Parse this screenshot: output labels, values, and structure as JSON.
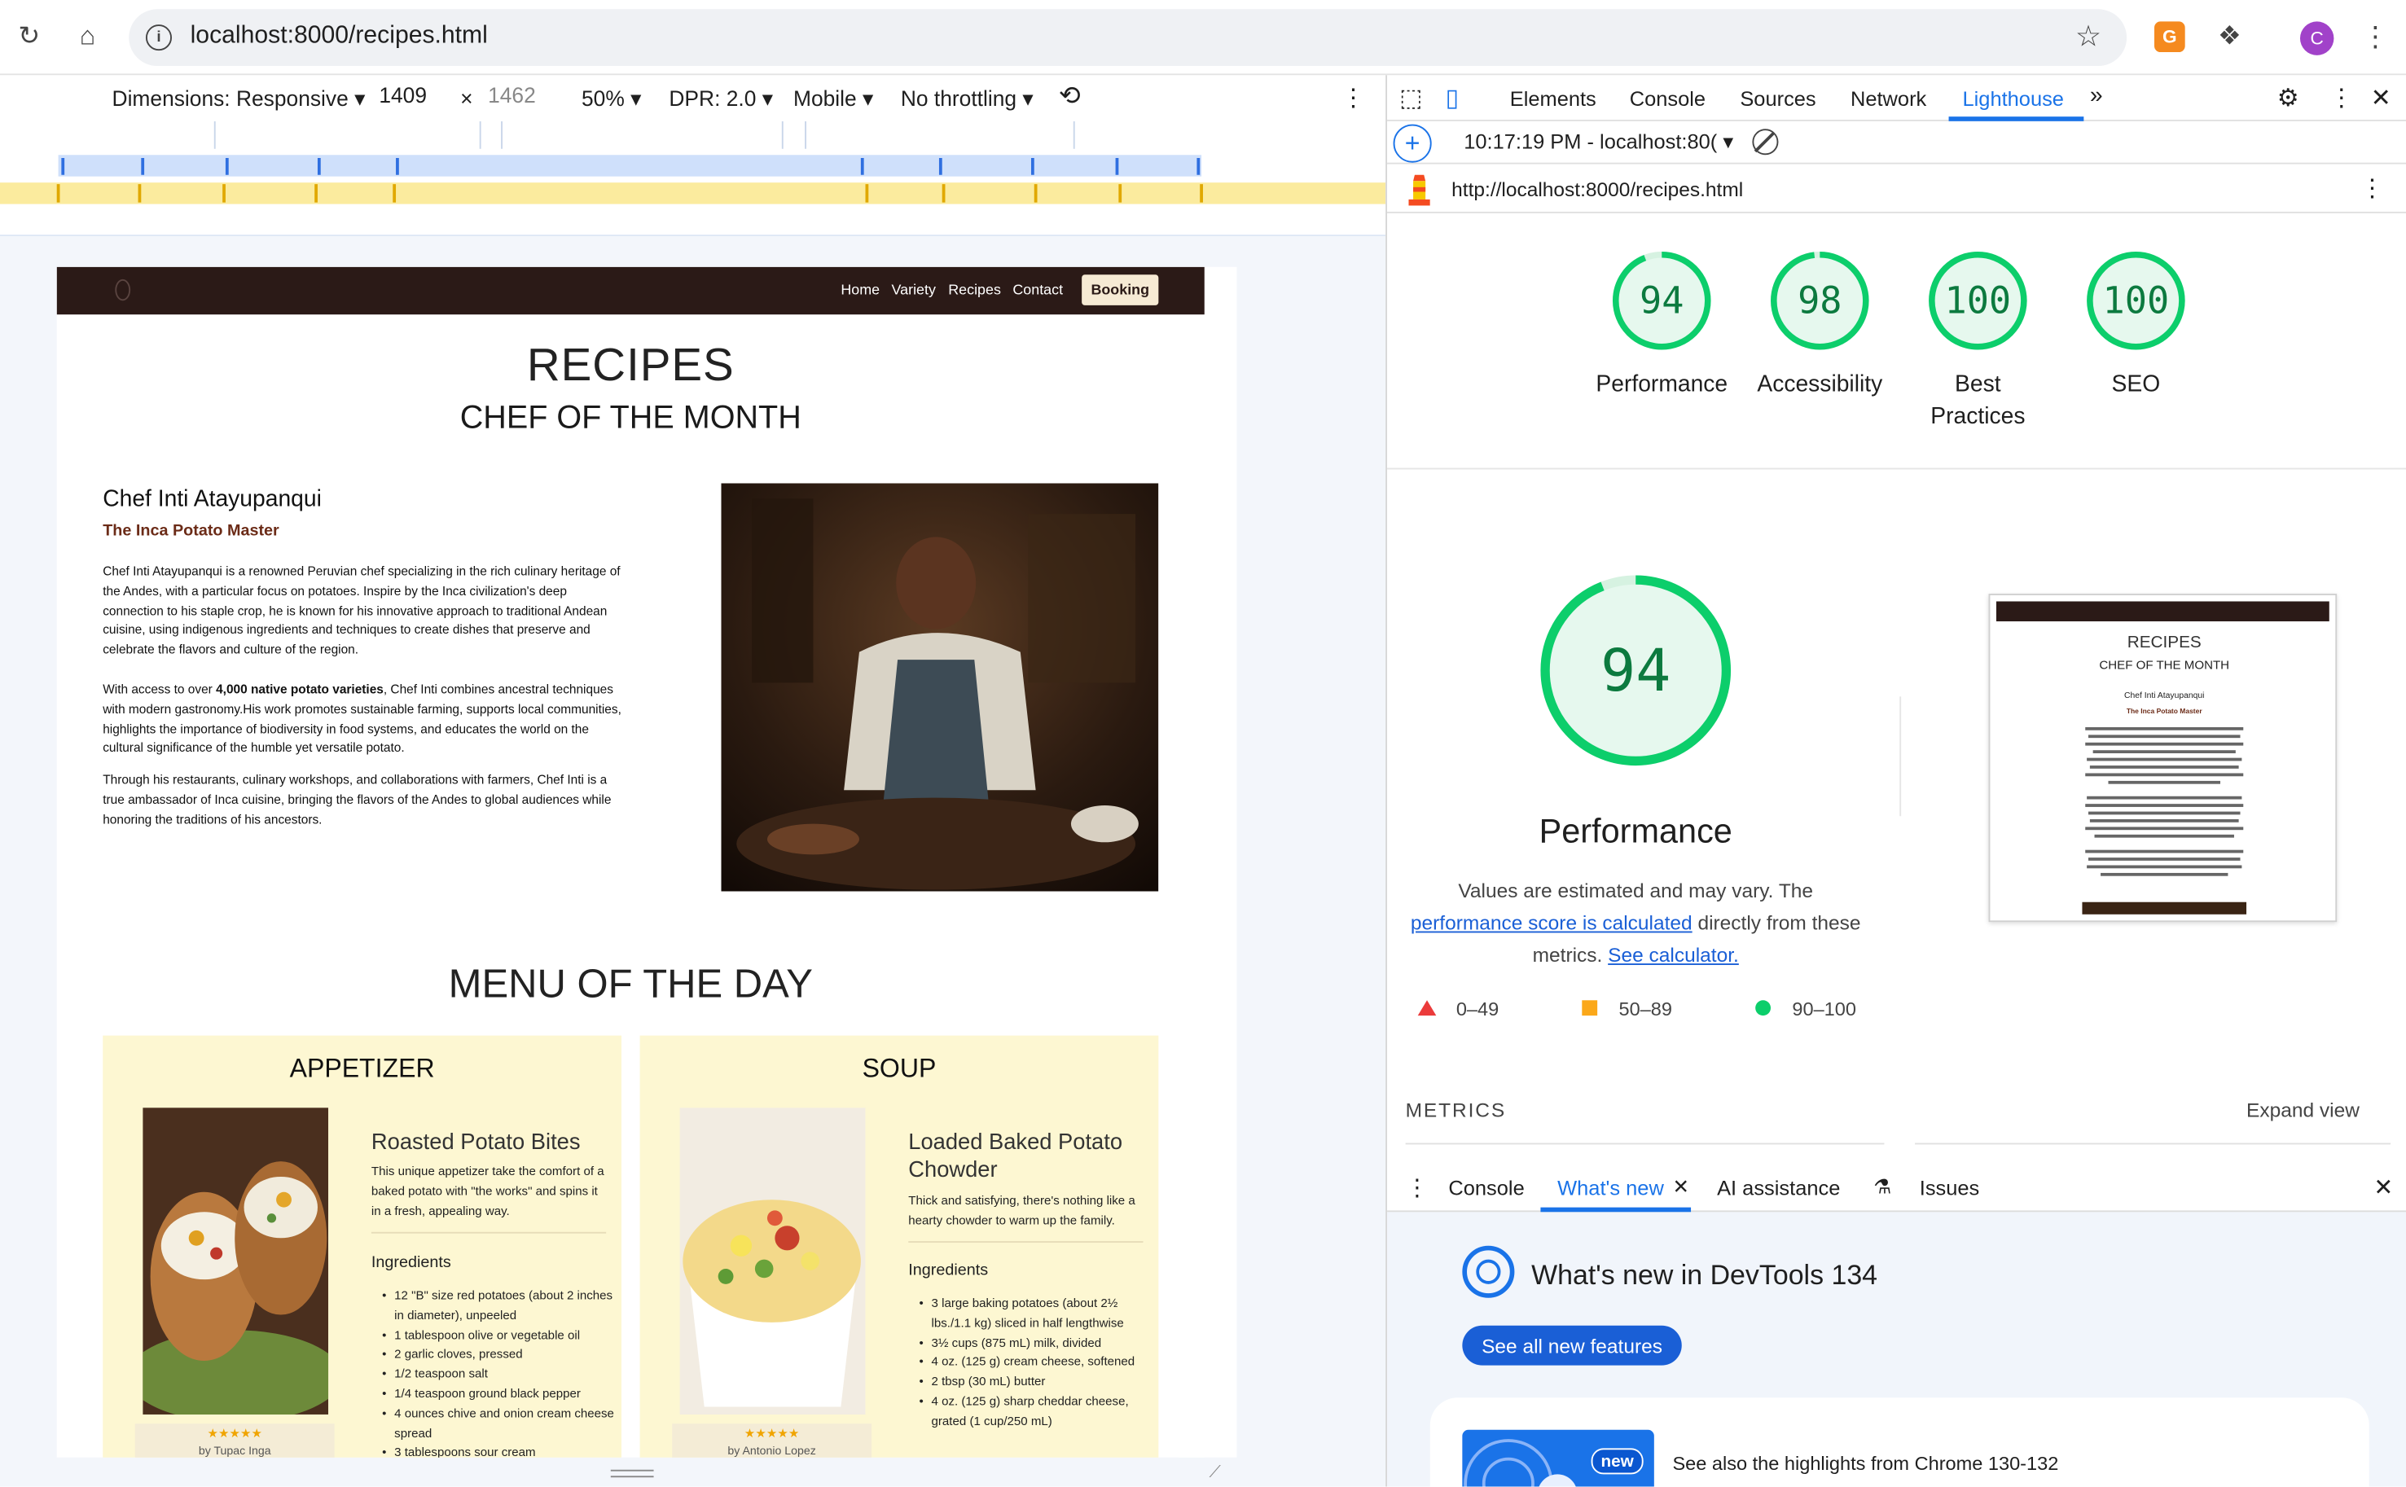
{
  "browser": {
    "url": "localhost:8000/recipes.html",
    "profile_initial": "C"
  },
  "device_toolbar": {
    "dimensions": "Dimensions: Responsive",
    "width": "1409",
    "height": "1462",
    "zoom": "50%",
    "dpr": "DPR: 2.0",
    "device_type": "Mobile",
    "throttling": "No throttling"
  },
  "site": {
    "nav": {
      "items": [
        "Home",
        "Variety",
        "Recipes",
        "Contact"
      ],
      "booking": "Booking"
    },
    "title": "RECIPES",
    "subtitle": "CHEF OF THE MONTH",
    "chef": {
      "name": "Chef Inti Atayupanqui",
      "title": "The Inca Potato Master",
      "p1": "Chef Inti Atayupanqui is a renowned Peruvian chef specializing in the rich culinary heritage of the Andes, with a particular focus on potatoes. Inspire by the Inca civilization's deep connection to his staple crop, he is known for his innovative approach to traditional Andean cuisine, using indigenous ingredients and techniques to create dishes that preserve and celebrate the flavors and culture of the region.",
      "p2_pre": "With access to over ",
      "p2_bold": "4,000 native potato varieties",
      "p2_post": ", Chef Inti combines ancestral techniques with modern gastronomy.His work promotes sustainable farming, supports local communities, highlights the importance of biodiversity in food systems, and educates the world on the cultural significance of the humble yet versatile potato.",
      "p3": "Through his restaurants, culinary workshops, and collaborations with farmers, Chef Inti is a true ambassador of Inca cuisine, bringing the flavors of the Andes to global audiences while honoring the traditions of his ancestors."
    },
    "menu_title": "MENU OF THE DAY",
    "cards": [
      {
        "heading": "APPETIZER",
        "title": "Roasted Potato Bites",
        "desc": "This unique appetizer take the comfort of a baked potato with \"the works\" and spins it in a fresh, appealing way.",
        "ingredients_label": "Ingredients",
        "ingredients": [
          "12 \"B\" size red potatoes (about 2 inches in diameter), unpeeled",
          "1 tablespoon olive or vegetable oil",
          "2 garlic cloves, pressed",
          "1/2 teaspoon salt",
          "1/4 teaspoon ground black pepper",
          "4 ounces chive and onion cream cheese spread",
          "3 tablespoons sour cream"
        ],
        "stars": "★★★★★",
        "author": "by Tupac Inga"
      },
      {
        "heading": "SOUP",
        "title": "Loaded Baked Potato Chowder",
        "desc": "Thick and satisfying, there's nothing like a hearty chowder to warm up the family.",
        "ingredients_label": "Ingredients",
        "ingredients": [
          "3 large baking potatoes (about 2½ lbs./1.1 kg) sliced in half lengthwise",
          "3½ cups (875 mL) milk, divided",
          "4 oz. (125 g) cream cheese, softened",
          "2 tbsp (30 mL) butter",
          "4 oz. (125 g) sharp cheddar cheese, grated (1 cup/250 mL)"
        ],
        "stars": "★★★★★",
        "author": "by Antonio Lopez"
      }
    ]
  },
  "devtools": {
    "tabs": [
      "Elements",
      "Console",
      "Sources",
      "Network",
      "Lighthouse"
    ],
    "report_time": "10:17:19 PM - localhost:80(",
    "report_url": "http://localhost:8000/recipes.html",
    "scores": [
      {
        "value": 94,
        "label": "Performance"
      },
      {
        "value": 98,
        "label": "Accessibility"
      },
      {
        "value": 100,
        "label": "Best Practices"
      },
      {
        "value": 100,
        "label": "SEO"
      }
    ],
    "perf": {
      "score": 94,
      "label": "Performance",
      "note_pre": "Values are estimated and may vary. The ",
      "note_link": "performance score is calculated",
      "note_mid": " directly from these metrics. ",
      "note_link2": "See calculator."
    },
    "legend": [
      "0–49",
      "50–89",
      "90–100"
    ],
    "legend_colors": {
      "fail": "#eb3b3b",
      "avg": "#fba81a",
      "pass": "#0cce6b"
    },
    "metrics_label": "METRICS",
    "expand_label": "Expand view",
    "thumb": {
      "title": "RECIPES",
      "subtitle": "CHEF OF THE MONTH",
      "chef": "Chef Inti Atayupanqui",
      "chef_title": "The Inca Potato Master"
    },
    "drawer": {
      "tabs": [
        "Console",
        "What's new",
        "AI assistance",
        "Issues"
      ],
      "whats_new_title": "What's new in DevTools 134",
      "see_all": "See all new features",
      "new_badge": "new",
      "highlights": "See also the highlights from Chrome 130-132"
    }
  }
}
